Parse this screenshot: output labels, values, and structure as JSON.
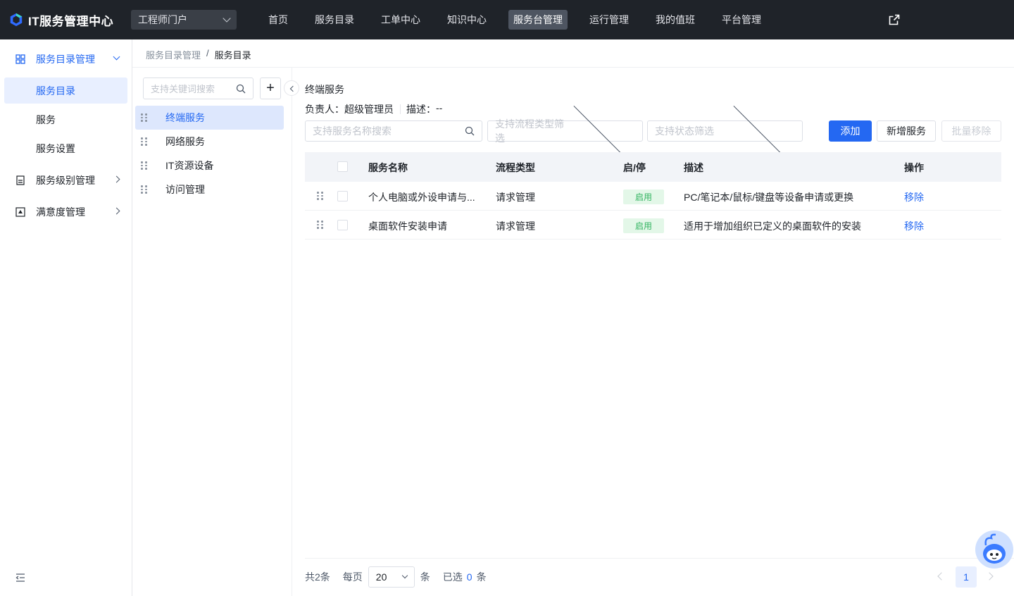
{
  "app": {
    "title": "IT服务管理中心",
    "portal": "工程师门户",
    "nav": [
      "首页",
      "服务目录",
      "工单中心",
      "知识中心",
      "服务台管理",
      "运行管理",
      "我的值班",
      "平台管理"
    ],
    "active_nav": "服务台管理"
  },
  "sidebar": {
    "groups": [
      {
        "label": "服务目录管理",
        "icon": "grid-icon",
        "expanded": true,
        "items": [
          "服务目录",
          "服务",
          "服务设置"
        ]
      },
      {
        "label": "服务级别管理",
        "icon": "sla-icon"
      },
      {
        "label": "满意度管理",
        "icon": "satisfaction-icon"
      }
    ],
    "active_item": "服务目录"
  },
  "breadcrumb": {
    "parent": "服务目录管理",
    "sep": "/",
    "current": "服务目录"
  },
  "tree": {
    "search_placeholder": "支持关键词搜索",
    "add_label": "+",
    "items": [
      "终端服务",
      "网络服务",
      "IT资源设备",
      "访问管理"
    ],
    "active": "终端服务"
  },
  "catalog": {
    "title": "终端服务",
    "owner_label": "负责人：",
    "owner": "超级管理员",
    "desc_label": "描述：",
    "desc": "--"
  },
  "filters": {
    "name_placeholder": "支持服务名称搜索",
    "flow_placeholder": "支持流程类型筛选",
    "status_placeholder": "支持状态筛选"
  },
  "buttons": {
    "add": "添加",
    "new_service": "新增服务",
    "batch_remove": "批量移除"
  },
  "table": {
    "headers": {
      "name": "服务名称",
      "flow": "流程类型",
      "status": "启/停",
      "desc": "描述",
      "op": "操作"
    },
    "rows": [
      {
        "name": "个人电脑或外设申请与...",
        "flow": "请求管理",
        "status": "启用",
        "desc": "PC/笔记本/鼠标/键盘等设备申请或更换",
        "op": "移除"
      },
      {
        "name": "桌面软件安装申请",
        "flow": "请求管理",
        "status": "启用",
        "desc": "适用于增加组织已定义的桌面软件的安装",
        "op": "移除"
      }
    ]
  },
  "pagination": {
    "total_text": "共2条",
    "per_page_label": "每页",
    "page_size": "20",
    "unit": "条",
    "selected_prefix": "已选",
    "selected_count": "0",
    "selected_suffix": "条",
    "current_page": "1"
  },
  "colors": {
    "primary": "#2468f2",
    "topbar": "#1f2329",
    "success": "#30b35f"
  }
}
